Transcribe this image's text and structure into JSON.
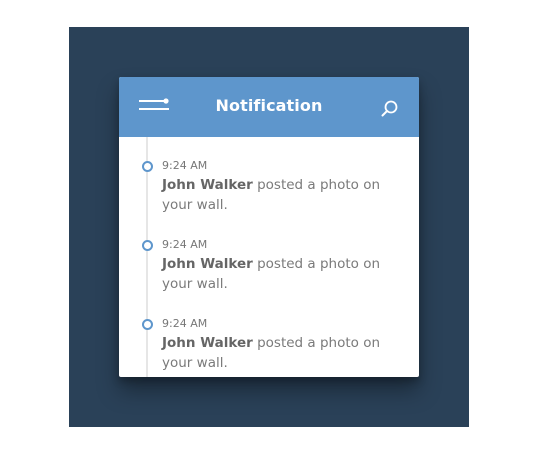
{
  "header": {
    "title": "Notification",
    "menu_icon": "menu-icon",
    "search_icon": "search-icon"
  },
  "colors": {
    "background": "#2a4158",
    "header": "#5e96cc",
    "card": "#ffffff",
    "timeline": "#e6e6e6"
  },
  "notifications": [
    {
      "time": "9:24 AM",
      "user": "John Walker",
      "action": "posted a photo on your wall."
    },
    {
      "time": "9:24 AM",
      "user": "John Walker",
      "action": "posted a photo on your wall."
    },
    {
      "time": "9:24 AM",
      "user": "John Walker",
      "action": "posted a photo on your wall."
    }
  ]
}
